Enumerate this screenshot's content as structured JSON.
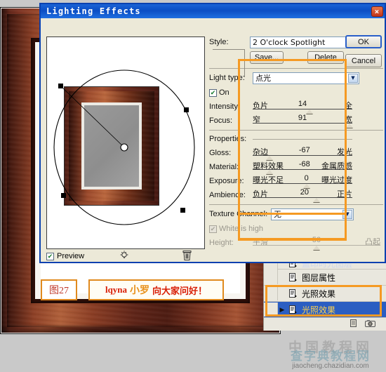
{
  "dialog": {
    "title": "Lighting Effects",
    "close_label": "×",
    "style_label": "Style:",
    "style_value": "2 O'clock Spotlight",
    "save_label": "Save...",
    "delete_label": "Delete",
    "ok_label": "OK",
    "cancel_label": "Cancel",
    "light_type_label": "Light type:",
    "light_type_value": "点光",
    "on_label": "On",
    "on_checked": "✔",
    "intensity_label": "Intensity:",
    "intensity_min_label": "负片",
    "intensity_max_label": "全",
    "intensity_value": "14",
    "focus_label": "Focus:",
    "focus_min_label": "窄",
    "focus_max_label": "宽",
    "focus_value": "91",
    "properties_label": "Properties:",
    "gloss_label": "Gloss:",
    "gloss_min_label": "杂边",
    "gloss_max_label": "发光",
    "gloss_value": "-67",
    "material_label": "Material:",
    "material_min_label": "塑料效果",
    "material_max_label": "金属质感",
    "material_value": "-68",
    "exposure_label": "Exposure:",
    "exposure_min_label": "曝光不足",
    "exposure_max_label": "曝光过度",
    "exposure_value": "0",
    "ambience_label": "Ambience:",
    "ambience_min_label": "负片",
    "ambience_max_label": "正片",
    "ambience_value": "20",
    "texture_channel_label": "Texture Channel:",
    "texture_channel_value": "无",
    "white_is_high_label": "White is high",
    "white_is_high_checked": "✔",
    "height_label": "Height:",
    "height_min_label": "平滑",
    "height_max_label": "凸起",
    "height_value": "50",
    "preview_label": "Preview",
    "preview_checked": "✔",
    "light_icon": "lightbulb-icon",
    "trash_icon": "trash-icon"
  },
  "layers": {
    "rows": [
      {
        "name": "盖印时光图层",
        "selected": false,
        "clipped": true,
        "expander": ""
      },
      {
        "name": "图层属性",
        "selected": false,
        "clipped": false,
        "expander": ""
      },
      {
        "name": "光照效果",
        "selected": false,
        "clipped": false,
        "expander": ""
      },
      {
        "name": "光照效果",
        "selected": true,
        "clipped": false,
        "expander": "▶"
      }
    ],
    "footer_icons": [
      "page-icon",
      "camera-icon"
    ]
  },
  "annotations": {
    "figure_label": "图27",
    "watermark_a": "lqyna",
    "watermark_b": "小罗",
    "watermark_c": "向大家问好！"
  },
  "site_watermark": {
    "line1": "中国教程网",
    "line2": "查字典教程网",
    "line3": "jiaocheng.chazidian.com"
  },
  "colors": {
    "titlebar": "#0b4ec4",
    "dialog_face": "#ece9d8",
    "highlight_orange": "#f59a23",
    "selection_blue": "#2b5ec2",
    "selected_text": "#ffd34d",
    "swatch": "#ffffff"
  }
}
